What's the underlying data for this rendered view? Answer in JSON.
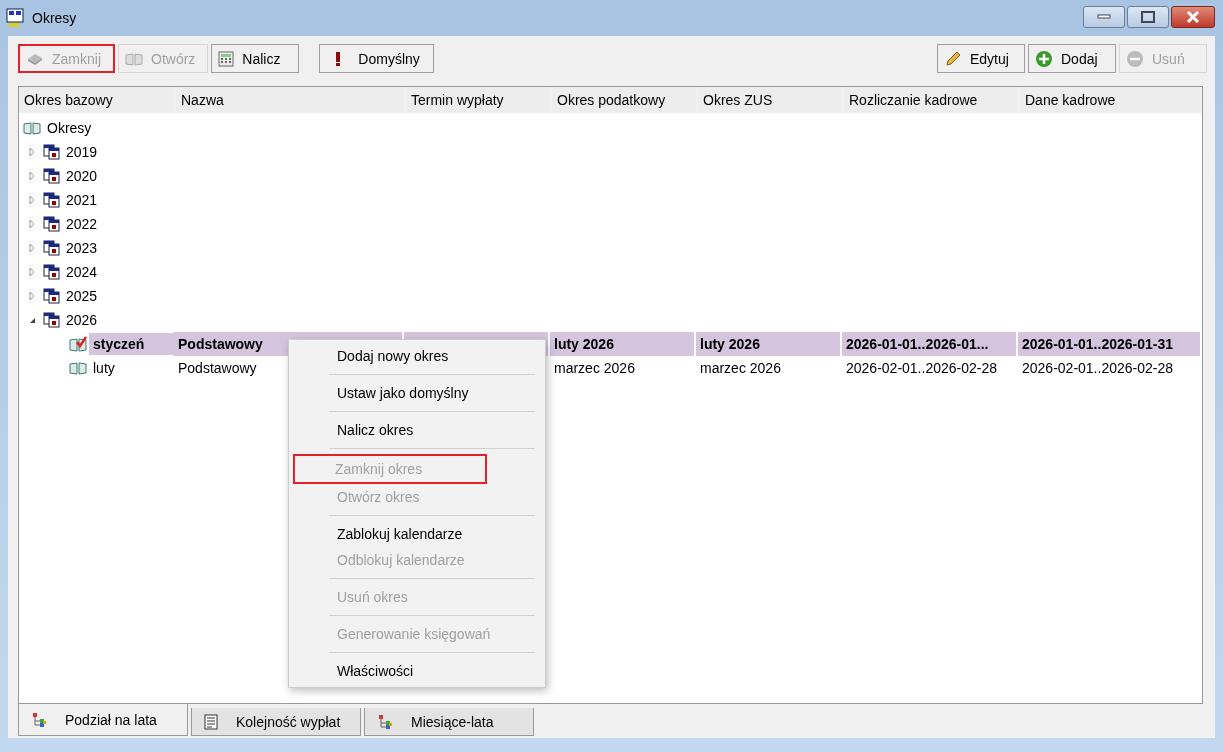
{
  "window": {
    "title": "Okresy"
  },
  "toolbar_left": [
    {
      "label": "Zamknij",
      "disabled": true,
      "highlighted": true
    },
    {
      "label": "Otwórz",
      "disabled": true,
      "highlighted": false
    },
    {
      "label": "Nalicz",
      "disabled": false,
      "highlighted": false
    },
    {
      "label": "Domyślny",
      "disabled": false,
      "highlighted": false
    }
  ],
  "toolbar_right": [
    {
      "label": "Edytuj",
      "disabled": false,
      "highlighted": false
    },
    {
      "label": "Dodaj",
      "disabled": false,
      "highlighted": false
    },
    {
      "label": "Usuń",
      "disabled": true,
      "highlighted": false
    }
  ],
  "table": {
    "columns": [
      "Okres bazowy",
      "Nazwa",
      "Termin wypłaty",
      "Okres podatkowy",
      "Okres ZUS",
      "Rozliczanie kadrowe",
      "Dane kadrowe"
    ],
    "tree": {
      "label": "Okresy",
      "kind": "root",
      "children": [
        {
          "label": "2019",
          "kind": "year",
          "expanded": false
        },
        {
          "label": "2020",
          "kind": "year",
          "expanded": false
        },
        {
          "label": "2021",
          "kind": "year",
          "expanded": false
        },
        {
          "label": "2022",
          "kind": "year",
          "expanded": false
        },
        {
          "label": "2023",
          "kind": "year",
          "expanded": false
        },
        {
          "label": "2024",
          "kind": "year",
          "expanded": false
        },
        {
          "label": "2025",
          "kind": "year",
          "expanded": false
        },
        {
          "label": "2026",
          "kind": "year",
          "expanded": true,
          "children": [
            {
              "label": "styczeń",
              "kind": "closed-month",
              "selected": true,
              "cells": [
                "Podstawowy",
                "",
                "luty 2026",
                "luty 2026",
                "2026-01-01..2026-01...",
                "2026-01-01..2026-01-31"
              ]
            },
            {
              "label": "luty",
              "kind": "month",
              "selected": false,
              "cells": [
                "Podstawowy",
                "",
                "marzec 2026",
                "marzec 2026",
                "2026-02-01..2026-02-28",
                "2026-02-01..2026-02-28"
              ]
            }
          ]
        }
      ]
    }
  },
  "context_menu": [
    [
      {
        "label": "Dodaj nowy okres",
        "disabled": false,
        "highlighted": false
      }
    ],
    [
      {
        "label": "Ustaw jako domyślny",
        "disabled": false,
        "highlighted": false
      }
    ],
    [
      {
        "label": "Nalicz okres",
        "disabled": false,
        "highlighted": false
      }
    ],
    [
      {
        "label": "Zamknij okres",
        "disabled": true,
        "highlighted": true
      },
      {
        "label": "Otwórz okres",
        "disabled": true,
        "highlighted": false
      }
    ],
    [
      {
        "label": "Zablokuj kalendarze",
        "disabled": false,
        "highlighted": false
      },
      {
        "label": "Odblokuj kalendarze",
        "disabled": true,
        "highlighted": false
      }
    ],
    [
      {
        "label": "Usuń okres",
        "disabled": true,
        "highlighted": false
      }
    ],
    [
      {
        "label": "Generowanie księgowań",
        "disabled": true,
        "highlighted": false
      }
    ],
    [
      {
        "label": "Właściwości",
        "disabled": false,
        "highlighted": false
      }
    ]
  ],
  "tabs": [
    {
      "label": "Podział na lata",
      "selected": true
    },
    {
      "label": "Kolejność wypłat",
      "selected": false
    },
    {
      "label": "Miesiące-lata",
      "selected": false
    }
  ]
}
